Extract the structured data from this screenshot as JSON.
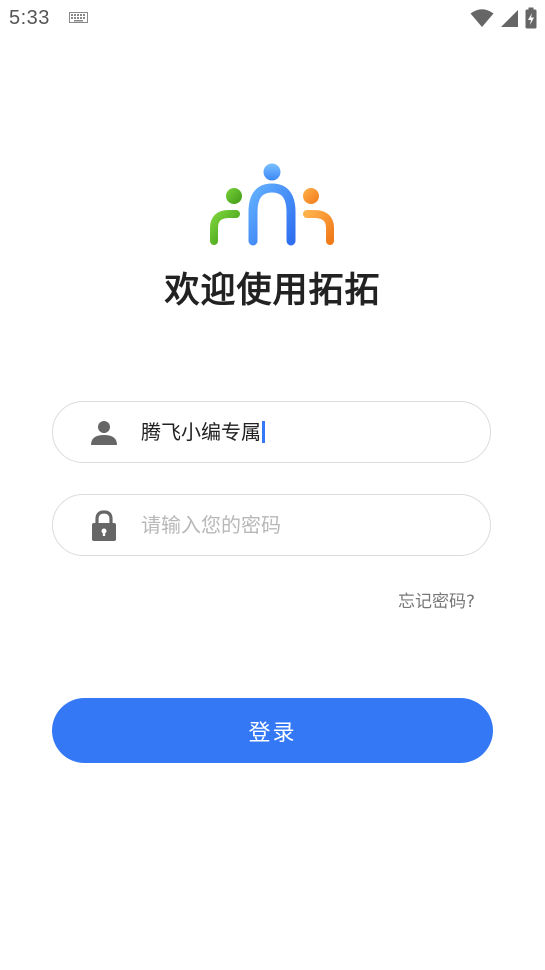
{
  "status_bar": {
    "time": "5:33",
    "icons": [
      "keyboard-icon",
      "wifi-icon",
      "signal-icon",
      "battery-charging-icon"
    ]
  },
  "app": {
    "logo_icon": "people-logo-icon",
    "welcome_title": "欢迎使用拓拓"
  },
  "login_form": {
    "username": {
      "icon": "user-icon",
      "value": "腾飞小编专属"
    },
    "password": {
      "icon": "lock-icon",
      "value": "",
      "placeholder": "请输入您的密码"
    },
    "forgot_password_label": "忘记密码?",
    "login_button_label": "登录"
  },
  "colors": {
    "accent": "#3478f6",
    "logo_green": "#4caf1e",
    "logo_blue": "#3d8bf5",
    "logo_orange": "#f58a23",
    "icon_gray": "#666666"
  }
}
